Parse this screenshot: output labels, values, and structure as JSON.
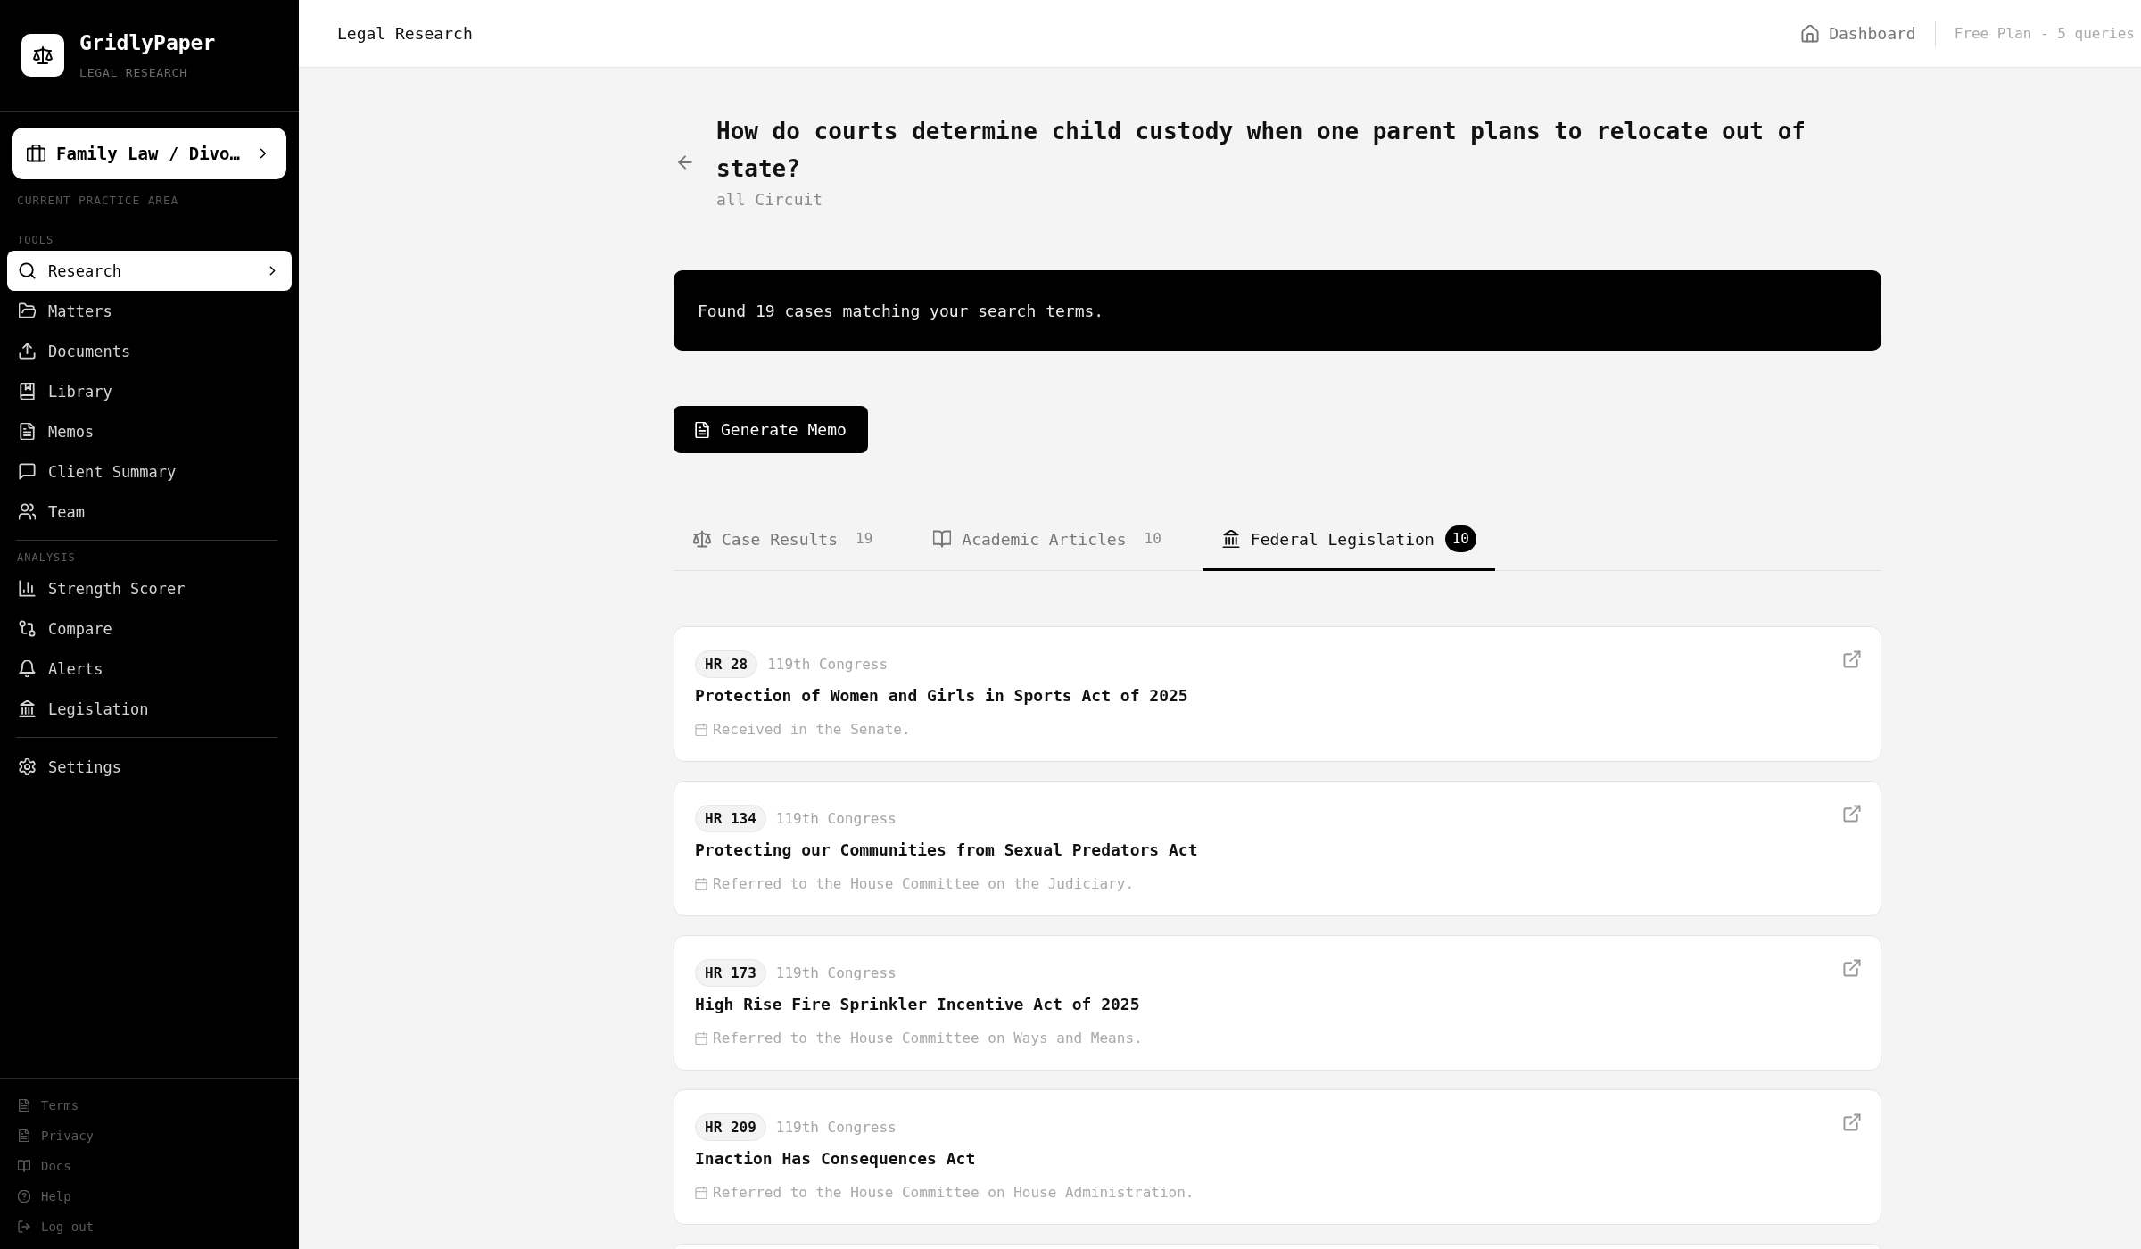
{
  "sidebar": {
    "brand": {
      "name": "GridlyPaper",
      "tagline": "LEGAL RESEARCH"
    },
    "practice_area": {
      "value": "Family Law / Divo…",
      "caption": "CURRENT PRACTICE AREA"
    },
    "sections": [
      {
        "heading": "TOOLS",
        "items": [
          {
            "label": "Research",
            "selected": true
          },
          {
            "label": "Matters",
            "selected": false
          },
          {
            "label": "Documents",
            "selected": false
          },
          {
            "label": "Library",
            "selected": false
          },
          {
            "label": "Memos",
            "selected": false
          },
          {
            "label": "Client Summary",
            "selected": false
          },
          {
            "label": "Team",
            "selected": false
          }
        ]
      },
      {
        "heading": "ANALYSIS",
        "items": [
          {
            "label": "Strength Scorer",
            "selected": false
          },
          {
            "label": "Compare",
            "selected": false
          },
          {
            "label": "Alerts",
            "selected": false
          },
          {
            "label": "Legislation",
            "selected": false
          }
        ]
      },
      {
        "items": [
          {
            "label": "Settings",
            "selected": false
          }
        ]
      }
    ],
    "footer_links": [
      "Terms",
      "Privacy",
      "Docs",
      "Help",
      "Log out"
    ]
  },
  "header": {
    "title": "Legal Research",
    "dashboard_link": "Dashboard",
    "plan": "Free Plan - 5 queries"
  },
  "query": {
    "question": "How do courts determine child custody when one parent plans to relocate out of state?",
    "jurisdiction": "all Circuit"
  },
  "notice": "Found 19 cases matching your search terms.",
  "generate_button": "Generate Memo",
  "tabs": [
    {
      "label": "Case Results",
      "count": "19",
      "selected": false
    },
    {
      "label": "Academic Articles",
      "count": "10",
      "selected": false
    },
    {
      "label": "Federal Legislation",
      "count": "10",
      "selected": true
    }
  ],
  "results": [
    {
      "bill": "HR 28",
      "congress": "119th Congress",
      "title": "Protection of Women and Girls in Sports Act of 2025",
      "status": "Received in the Senate."
    },
    {
      "bill": "HR 134",
      "congress": "119th Congress",
      "title": "Protecting our Communities from Sexual Predators Act",
      "status": "Referred to the House Committee on the Judiciary."
    },
    {
      "bill": "HR 173",
      "congress": "119th Congress",
      "title": "High Rise Fire Sprinkler Incentive Act of 2025",
      "status": "Referred to the House Committee on Ways and Means."
    },
    {
      "bill": "HR 209",
      "congress": "119th Congress",
      "title": "Inaction Has Consequences Act",
      "status": "Referred to the House Committee on House Administration."
    }
  ]
}
